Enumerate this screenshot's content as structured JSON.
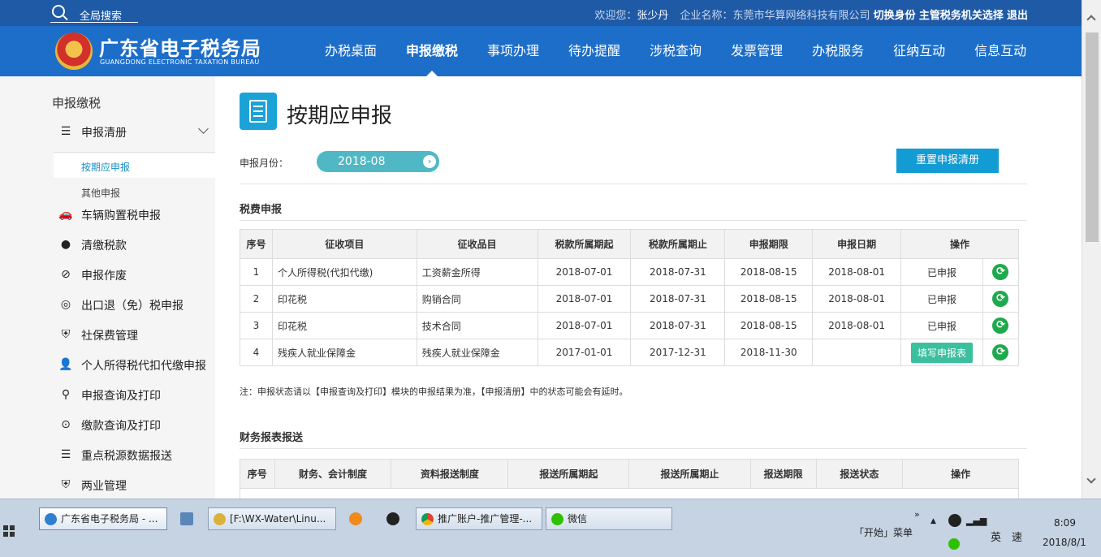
{
  "topbar": {
    "search_label": "全局搜索",
    "welcome_prefix": "欢迎您：",
    "user_name": "张少丹",
    "company_prefix": "企业名称：",
    "company_name": "东莞市华算网络科技有限公司",
    "switch_identity": "切换身份",
    "choose_authority": "主管税务机关选择",
    "logout": "退出"
  },
  "header": {
    "logo_cn": "广东省电子税务局",
    "logo_en": "GUANGDONG ELECTRONIC TAXATION BUREAU",
    "nav": [
      {
        "label": "办税桌面"
      },
      {
        "label": "申报缴税"
      },
      {
        "label": "事项办理"
      },
      {
        "label": "待办提醒"
      },
      {
        "label": "涉税查询"
      },
      {
        "label": "发票管理"
      },
      {
        "label": "办税服务"
      },
      {
        "label": "征纳互动"
      },
      {
        "label": "信息互动"
      }
    ],
    "active_nav": "申报缴税"
  },
  "sidebar": {
    "title": "申报缴税",
    "group_label": "申报清册",
    "sub_items": [
      {
        "label": "按期应申报"
      },
      {
        "label": "其他申报"
      }
    ],
    "items": [
      {
        "label": "车辆购置税申报",
        "icon": "car-icon"
      },
      {
        "label": "清缴税款",
        "icon": "money-bag-icon"
      },
      {
        "label": "申报作废",
        "icon": "void-document-icon"
      },
      {
        "label": "出口退（免）税申报",
        "icon": "globe-icon"
      },
      {
        "label": "社保费管理",
        "icon": "shield-icon"
      },
      {
        "label": "个人所得税代扣代缴申报",
        "icon": "person-icon"
      },
      {
        "label": "申报查询及打印",
        "icon": "search-icon"
      },
      {
        "label": "缴款查询及打印",
        "icon": "coin-icon"
      },
      {
        "label": "重点税源数据报送",
        "icon": "list-icon"
      },
      {
        "label": "两业管理",
        "icon": "shield-icon"
      }
    ]
  },
  "main": {
    "title": "按期应申报",
    "month_label": "申报月份：",
    "month_value": "2018-08",
    "reset_button": "重置申报清册",
    "tax_section_title": "税费申报",
    "tax_table": {
      "headers": [
        "序号",
        "征收项目",
        "征收品目",
        "税款所属期起",
        "税款所属期止",
        "申报期限",
        "申报日期",
        "操作"
      ],
      "rows": [
        {
          "no": "1",
          "item": "个人所得税(代扣代缴)",
          "category": "工资薪金所得",
          "start": "2018-07-01",
          "end": "2018-07-31",
          "deadline": "2018-08-15",
          "date": "2018-08-01",
          "status": "已申报"
        },
        {
          "no": "2",
          "item": "印花税",
          "category": "购销合同",
          "start": "2018-07-01",
          "end": "2018-07-31",
          "deadline": "2018-08-15",
          "date": "2018-08-01",
          "status": "已申报"
        },
        {
          "no": "3",
          "item": "印花税",
          "category": "技术合同",
          "start": "2018-07-01",
          "end": "2018-07-31",
          "deadline": "2018-08-15",
          "date": "2018-08-01",
          "status": "已申报"
        },
        {
          "no": "4",
          "item": "残疾人就业保障金",
          "category": "残疾人就业保障金",
          "start": "2017-01-01",
          "end": "2017-12-31",
          "deadline": "2018-11-30",
          "date": "",
          "status": "填写申报表"
        }
      ]
    },
    "note": "注：申报状态请以【申报查询及打印】模块的申报结果为准，【申报清册】中的状态可能会有延时。",
    "finance_section_title": "财务报表报送",
    "finance_table": {
      "headers": [
        "序号",
        "财务、会计制度",
        "资料报送制度",
        "报送所属期起",
        "报送所属期止",
        "报送期限",
        "报送状态",
        "操作"
      ]
    }
  },
  "taskbar": {
    "buttons": [
      {
        "label": "广东省电子税务局 - ..."
      },
      {
        "label": "[F:\\WX-Water\\Linu..."
      },
      {
        "label": "推广账户-推广管理-..."
      },
      {
        "label": "微信"
      }
    ],
    "start_menu": "「开始」菜单",
    "ime_lang": "英",
    "ime_mode": "速",
    "time": "8:09",
    "date": "2018/8/1"
  }
}
